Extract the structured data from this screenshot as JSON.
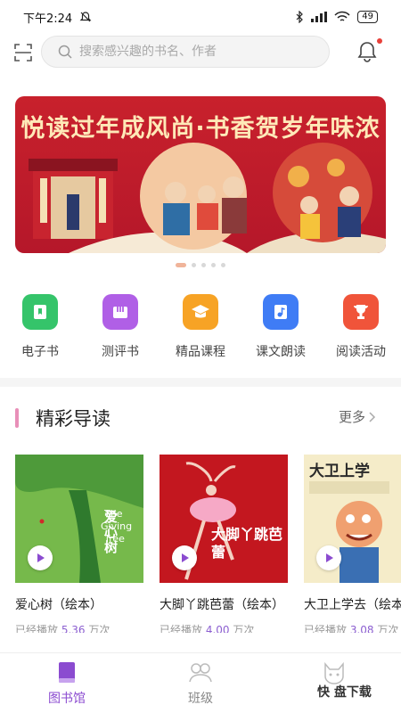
{
  "status": {
    "time": "下午2:24",
    "battery": "49"
  },
  "search": {
    "placeholder": "搜索感兴趣的书名、作者"
  },
  "banner": {
    "title": "悦读过年成风尚·书香贺岁年味浓"
  },
  "quick_menu": [
    {
      "label": "电子书",
      "icon": "ebook-icon",
      "color": "#35c46a"
    },
    {
      "label": "测评书",
      "icon": "test-icon",
      "color": "#b05fe6"
    },
    {
      "label": "精品课程",
      "icon": "course-icon",
      "color": "#f7a325"
    },
    {
      "label": "课文朗读",
      "icon": "read-aloud-icon",
      "color": "#3f7cf5"
    },
    {
      "label": "阅读活动",
      "icon": "trophy-icon",
      "color": "#f0543a"
    }
  ],
  "section": {
    "title": "精彩导读",
    "more": "更多"
  },
  "books": [
    {
      "title": "爱心树（绘本）",
      "played_prefix": "已经播放",
      "count": "5.36",
      "unit": "万次",
      "cover_text": "爱心树"
    },
    {
      "title": "大脚丫跳芭蕾（绘本）",
      "played_prefix": "已经播放",
      "count": "4.00",
      "unit": "万次",
      "cover_text": "大脚丫跳芭蕾"
    },
    {
      "title": "大卫上学去（绘本）",
      "played_prefix": "已经播放",
      "count": "3.08",
      "unit": "万次",
      "cover_text": "大卫上学"
    }
  ],
  "tabs": [
    {
      "label": "图书馆",
      "active": true
    },
    {
      "label": "班级",
      "active": false
    },
    {
      "label": "",
      "active": false
    }
  ],
  "watermark": "快 盘下载"
}
